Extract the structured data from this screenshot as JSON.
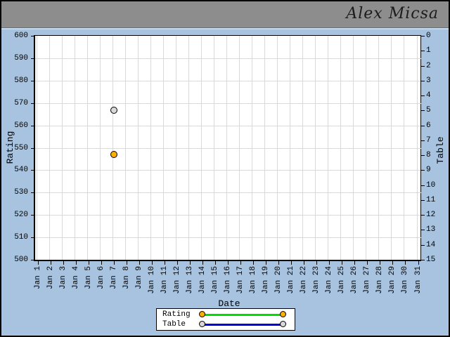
{
  "header": {
    "title": "Alex Micsa"
  },
  "colors": {
    "background": "#a7c3e0",
    "header_bar": "#8d8d8d",
    "plot_background": "#ffffff",
    "gridline": "#d9d9d9",
    "axis": "#000000"
  },
  "chart_data": {
    "type": "scatter",
    "title": "",
    "xlabel": "Date",
    "grid": true,
    "legend_position": "bottom-center",
    "x_categories": [
      "Jan 1",
      "Jan 2",
      "Jan 3",
      "Jan 4",
      "Jan 5",
      "Jan 6",
      "Jan 7",
      "Jan 8",
      "Jan 9",
      "Jan 10",
      "Jan 11",
      "Jan 12",
      "Jan 13",
      "Jan 14",
      "Jan 15",
      "Jan 16",
      "Jan 17",
      "Jan 18",
      "Jan 19",
      "Jan 20",
      "Jan 21",
      "Jan 22",
      "Jan 23",
      "Jan 24",
      "Jan 25",
      "Jan 26",
      "Jan 27",
      "Jan 28",
      "Jan 29",
      "Jan 30",
      "Jan 31"
    ],
    "left_axis": {
      "label": "Rating",
      "min": 500,
      "max": 600,
      "step": 10,
      "ticks": [
        600,
        590,
        580,
        570,
        560,
        550,
        540,
        530,
        520,
        510,
        500
      ],
      "direction": "increasing-up"
    },
    "right_axis": {
      "label": "Table",
      "min": 0,
      "max": 15,
      "step": 1,
      "ticks": [
        0,
        1,
        2,
        3,
        4,
        5,
        6,
        7,
        8,
        9,
        10,
        11,
        12,
        13,
        14,
        15
      ],
      "direction": "increasing-down"
    },
    "series": [
      {
        "name": "Rating",
        "axis": "left",
        "marker_color": "#ffad00",
        "line_color": "#00dd00",
        "points": [
          {
            "x": "Jan 7",
            "y": 547
          }
        ]
      },
      {
        "name": "Table",
        "axis": "right",
        "marker_color": "#d8d8d8",
        "line_color": "#0000dd",
        "points": [
          {
            "x": "Jan 7",
            "y": 5
          }
        ]
      }
    ]
  }
}
